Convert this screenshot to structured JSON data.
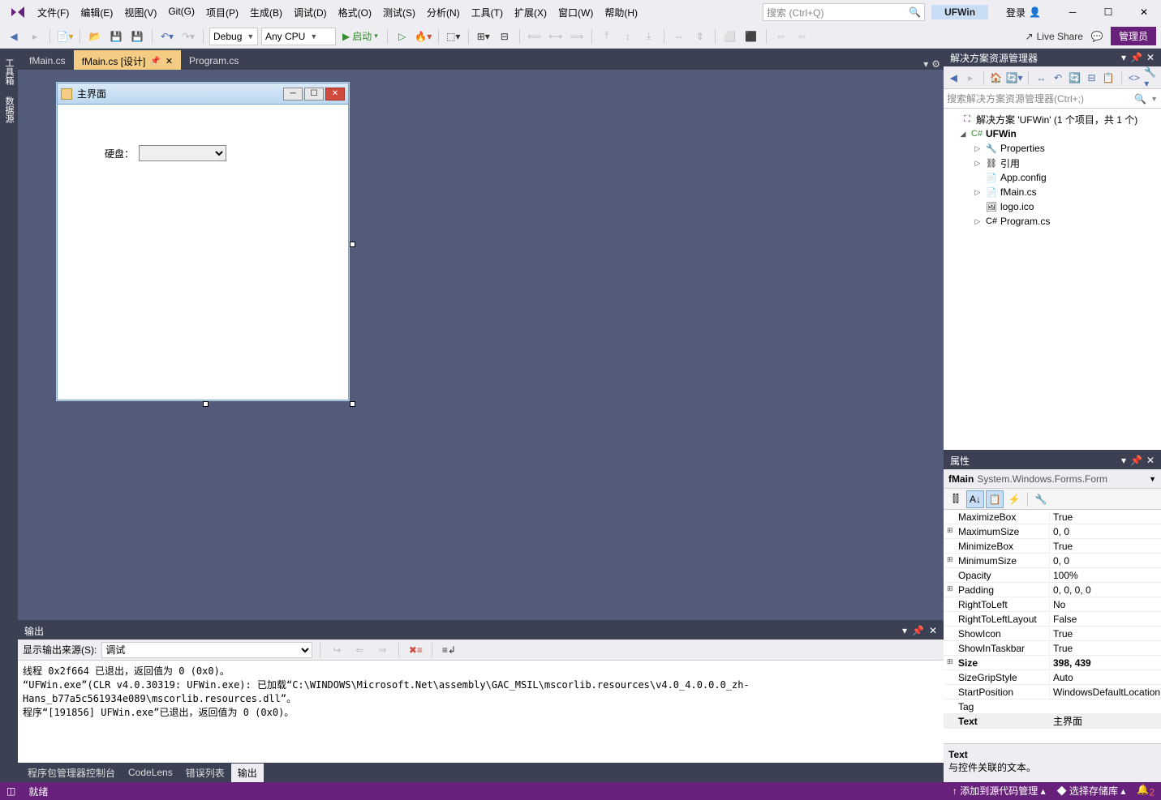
{
  "menubar": [
    "文件(F)",
    "编辑(E)",
    "视图(V)",
    "Git(G)",
    "项目(P)",
    "生成(B)",
    "调试(D)",
    "格式(O)",
    "测试(S)",
    "分析(N)",
    "工具(T)",
    "扩展(X)",
    "窗口(W)",
    "帮助(H)"
  ],
  "search_placeholder": "搜索 (Ctrl+Q)",
  "title_tag": "UFWin",
  "login_text": "登录",
  "toolbar": {
    "config": "Debug",
    "platform": "Any CPU",
    "start": "启动"
  },
  "live_share": "Live Share",
  "admin": "管理员",
  "left_tabs": [
    "工具箱",
    "数据源"
  ],
  "tabs": [
    {
      "label": "fMain.cs",
      "active": false
    },
    {
      "label": "fMain.cs [设计]",
      "active": true
    },
    {
      "label": "Program.cs",
      "active": false
    }
  ],
  "form": {
    "title": "主界面",
    "label": "硬盘："
  },
  "output": {
    "title": "输出",
    "source_label": "显示输出来源(S):",
    "source_value": "调试",
    "text": "线程 0x2f664 已退出，返回值为 0 (0x0)。\n“UFWin.exe”(CLR v4.0.30319: UFWin.exe): 已加载“C:\\WINDOWS\\Microsoft.Net\\assembly\\GAC_MSIL\\mscorlib.resources\\v4.0_4.0.0.0_zh-Hans_b77a5c561934e089\\mscorlib.resources.dll”。\n程序“[191856] UFWin.exe”已退出，返回值为 0 (0x0)。\n"
  },
  "bottom_tabs": [
    "程序包管理器控制台",
    "CodeLens",
    "错误列表",
    "输出"
  ],
  "bottom_active": 3,
  "solution": {
    "panel_title": "解决方案资源管理器",
    "search_placeholder": "搜索解决方案资源管理器(Ctrl+;)",
    "root": "解决方案 'UFWin' (1 个项目，共 1 个)",
    "project": "UFWin",
    "items": [
      {
        "icon": "🔧",
        "label": "Properties",
        "exp": "▷"
      },
      {
        "icon": "⛓",
        "label": "引用",
        "exp": "▷"
      },
      {
        "icon": "📄",
        "label": "App.config",
        "exp": ""
      },
      {
        "icon": "📄",
        "label": "fMain.cs",
        "exp": "▷"
      },
      {
        "icon": "🖼",
        "label": "logo.ico",
        "exp": ""
      },
      {
        "icon": "C#",
        "label": "Program.cs",
        "exp": "▷"
      }
    ]
  },
  "properties": {
    "panel_title": "属性",
    "obj_name": "fMain",
    "obj_type": "System.Windows.Forms.Form",
    "rows": [
      {
        "exp": "",
        "k": "MaximizeBox",
        "v": "True"
      },
      {
        "exp": "⊞",
        "k": "MaximumSize",
        "v": "0, 0"
      },
      {
        "exp": "",
        "k": "MinimizeBox",
        "v": "True"
      },
      {
        "exp": "⊞",
        "k": "MinimumSize",
        "v": "0, 0"
      },
      {
        "exp": "",
        "k": "Opacity",
        "v": "100%"
      },
      {
        "exp": "⊞",
        "k": "Padding",
        "v": "0, 0, 0, 0"
      },
      {
        "exp": "",
        "k": "RightToLeft",
        "v": "No"
      },
      {
        "exp": "",
        "k": "RightToLeftLayout",
        "v": "False"
      },
      {
        "exp": "",
        "k": "ShowIcon",
        "v": "True"
      },
      {
        "exp": "",
        "k": "ShowInTaskbar",
        "v": "True"
      },
      {
        "exp": "⊞",
        "k": "Size",
        "v": "398, 439",
        "bold": true
      },
      {
        "exp": "",
        "k": "SizeGripStyle",
        "v": "Auto"
      },
      {
        "exp": "",
        "k": "StartPosition",
        "v": "WindowsDefaultLocation"
      },
      {
        "exp": "",
        "k": "Tag",
        "v": ""
      },
      {
        "exp": "",
        "k": "Text",
        "v": "主界面",
        "selected": true
      }
    ],
    "desc_title": "Text",
    "desc_text": "与控件关联的文本。"
  },
  "status": {
    "ready": "就绪",
    "add_source": "添加到源代码管理",
    "select_repo": "选择存储库",
    "notif": "2"
  }
}
